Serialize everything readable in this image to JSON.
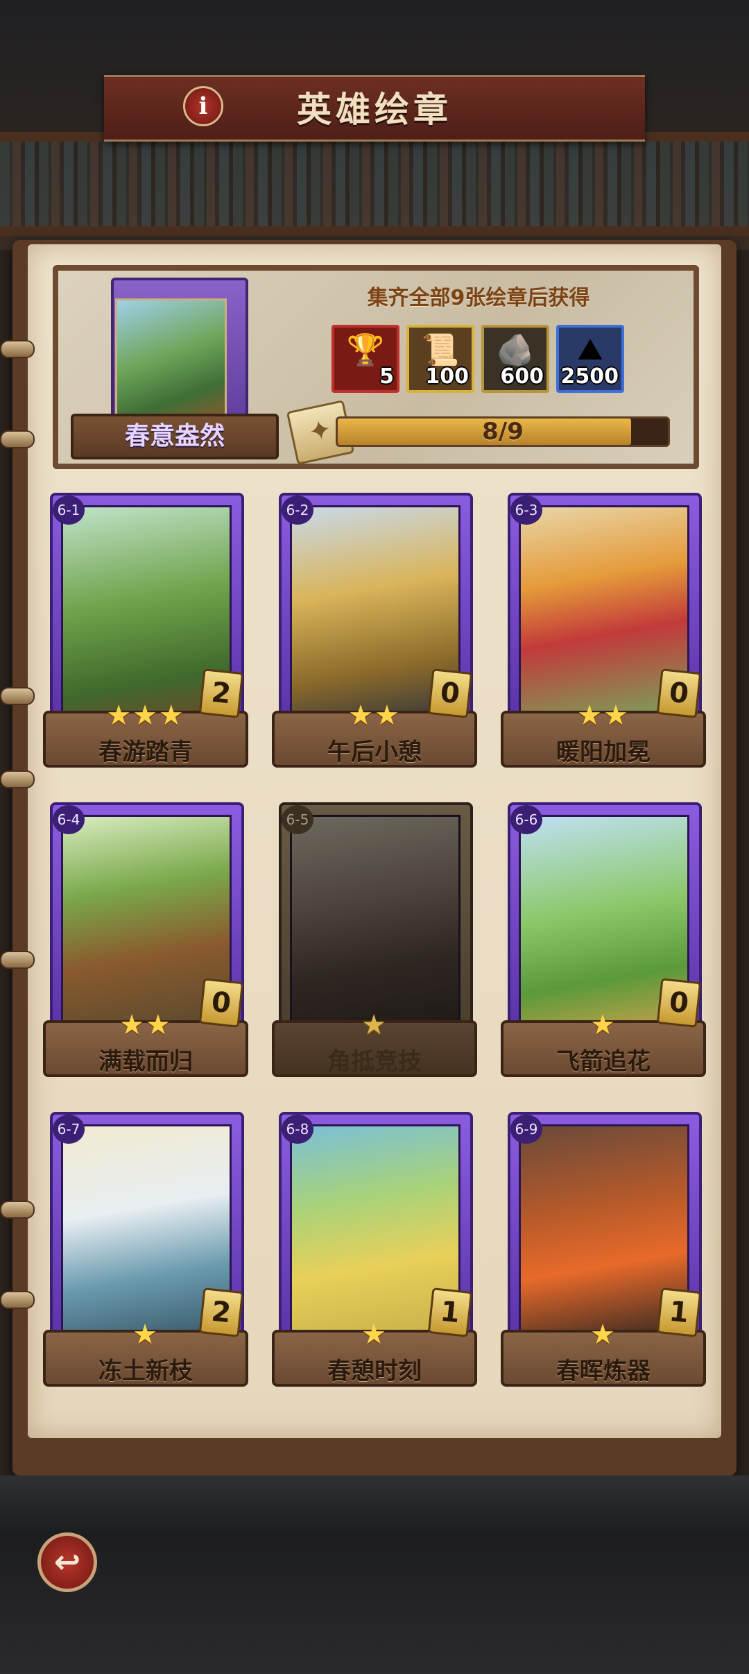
{
  "header": {
    "title": "英雄绘章",
    "info_icon": "i"
  },
  "album": {
    "name": "春意盎然",
    "reward_title": "集齐全部9张绘章后获得",
    "rewards": [
      {
        "icon": "chest-icon",
        "glyph": "🏆",
        "amount": "5",
        "border": "#c0302a",
        "bg": "#7a1a14"
      },
      {
        "icon": "scroll-icon",
        "glyph": "📜",
        "amount": "100",
        "border": "#d8b23a",
        "bg": "#5a4020"
      },
      {
        "icon": "ore-icon",
        "glyph": "🪨",
        "amount": "600",
        "border": "#b8943a",
        "bg": "#3b3226"
      },
      {
        "icon": "gold-ore-icon",
        "glyph": "⛰",
        "amount": "2500",
        "border": "#3c6fd8",
        "bg": "#2a3a66"
      }
    ],
    "progress": {
      "collected": 8,
      "total": 9,
      "text": "8/9"
    }
  },
  "cards": [
    {
      "num": "6-1",
      "name": "春游踏青",
      "stars": "★★★",
      "count": "2",
      "locked": false,
      "art": "linear-gradient(170deg,#bfe3c9 0%,#6fa24a 45%,#3f6a2c 80%,#6a4a2a 100%)"
    },
    {
      "num": "6-2",
      "name": "午后小憩",
      "stars": "★★",
      "count": "0",
      "locked": false,
      "art": "linear-gradient(170deg,#c9d9e8 0%,#d9b45a 40%,#8c6a2a 75%,#3a3a3a 100%)"
    },
    {
      "num": "6-3",
      "name": "暖阳加冕",
      "stars": "★★",
      "count": "0",
      "locked": false,
      "art": "linear-gradient(170deg,#e8d6a8 0%,#e59a3a 35%,#c23a3a 60%,#7aa25a 100%)"
    },
    {
      "num": "6-4",
      "name": "满载而归",
      "stars": "★★",
      "count": "0",
      "locked": false,
      "art": "linear-gradient(170deg,#d8ecc0 0%,#7aa84a 35%,#8a5a2e 65%,#5a4a2e 100%)"
    },
    {
      "num": "6-5",
      "name": "角抵竞技",
      "stars": "★",
      "count": "",
      "locked": true,
      "art": "linear-gradient(170deg,#b8a880 0%,#8a6a4a 40%,#5a3a2a 70%,#3a2a1e 100%)"
    },
    {
      "num": "6-6",
      "name": "飞箭追花",
      "stars": "★",
      "count": "0",
      "locked": false,
      "art": "linear-gradient(170deg,#bfe0f2 0%,#8cc86a 45%,#5a9a3a 75%,#c2a04a 100%)"
    },
    {
      "num": "6-7",
      "name": "冻土新枝",
      "stars": "★",
      "count": "2",
      "locked": false,
      "art": "linear-gradient(170deg,#f2ead0 0%,#e8eef2 40%,#6a9aae 70%,#3a5a6a 100%)"
    },
    {
      "num": "6-8",
      "name": "春憩时刻",
      "stars": "★",
      "count": "1",
      "locked": false,
      "art": "linear-gradient(170deg,#7ac0d8 0%,#a8d27a 35%,#e8d05a 65%,#c9b04a 100%)"
    },
    {
      "num": "6-9",
      "name": "春晖炼器",
      "stars": "★",
      "count": "1",
      "locked": false,
      "art": "linear-gradient(170deg,#6a4a3a 0%,#b85a2a 40%,#e86a2a 65%,#3a2a22 100%)"
    }
  ],
  "back_icon": "↩"
}
